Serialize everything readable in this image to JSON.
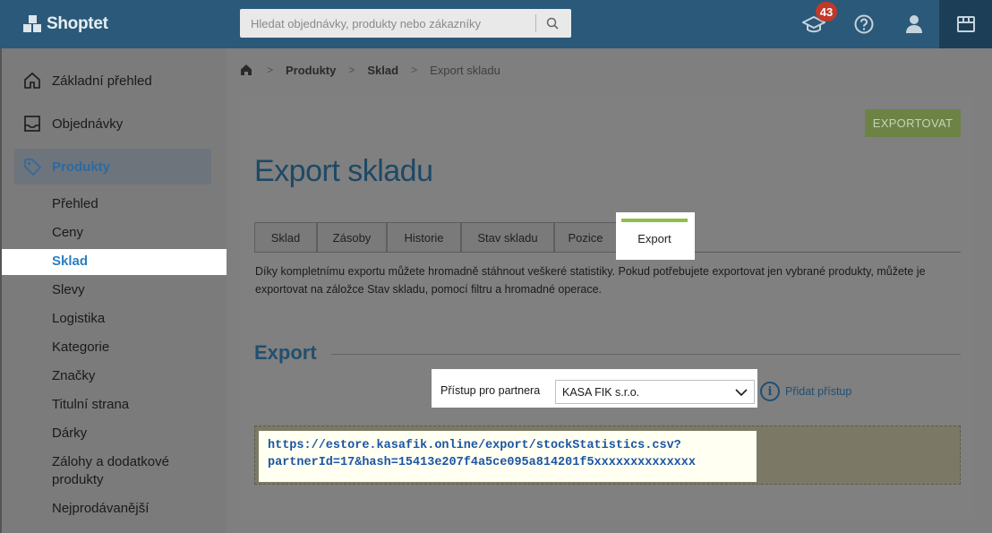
{
  "header": {
    "logo_text": "Shoptet",
    "search_placeholder": "Hledat objednávky, produkty nebo zákazníky",
    "notifications_count": "43"
  },
  "sidebar": {
    "main_items": [
      {
        "label": "Základní přehled",
        "icon": "home-icon"
      },
      {
        "label": "Objednávky",
        "icon": "inbox-icon"
      },
      {
        "label": "Produkty",
        "icon": "tag-icon"
      }
    ],
    "sub_items": [
      "Přehled",
      "Ceny",
      "Sklad",
      "Slevy",
      "Logistika",
      "Kategorie",
      "Značky",
      "Titulní strana",
      "Dárky",
      "Zálohy a dodatkové",
      "produkty",
      "Nejprodávanější"
    ]
  },
  "breadcrumb": {
    "items": [
      "Produkty",
      "Sklad",
      "Export skladu"
    ]
  },
  "page": {
    "title": "Export skladu",
    "export_button": "EXPORTOVAT",
    "tabs": [
      "Sklad",
      "Zásoby",
      "Historie",
      "Stav skladu",
      "Pozice",
      "Export"
    ],
    "active_tab": "Export",
    "description": "Díky kompletnímu exportu můžete hromadně stáhnout veškeré statistiky. Pokud potřebujete exportovat jen vybrané produkty, můžete je exportovat na záložce Stav skladu, pomocí filtru a hromadné operace.",
    "section_title": "Export",
    "partner_label": "Přístup pro partnera",
    "partner_value": "KASA FIK s.r.o.",
    "add_access": "Přidat přístup",
    "url_line1": "https://estore.kasafik.online/export/stockStatistics.csv?",
    "url_line2": "partnerId=17&hash=15413e207f4a5ce095a814201f5xxxxxxxxxxxxxx"
  },
  "colors": {
    "topbar": "#2a5979",
    "accent_green": "#8fbf4a",
    "link_blue": "#2d7fc1"
  }
}
